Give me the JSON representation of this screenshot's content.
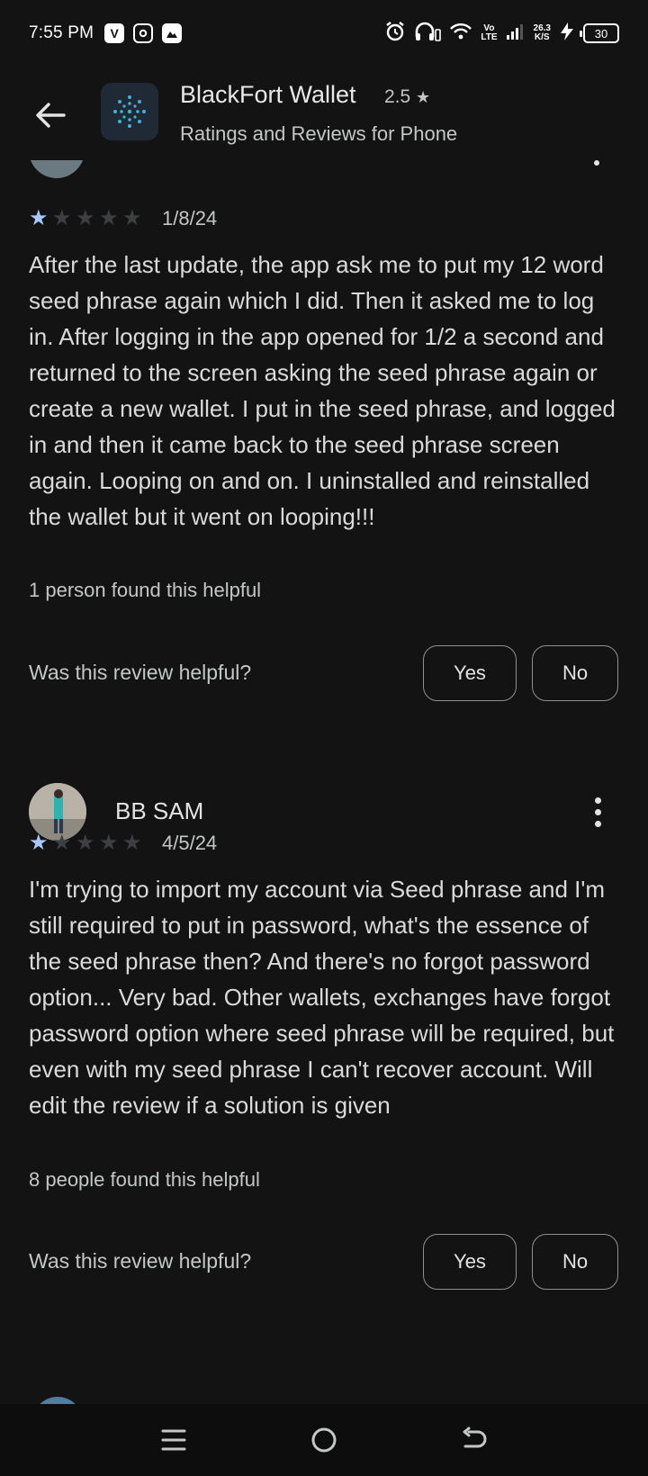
{
  "status_bar": {
    "time": "7:55 PM",
    "app_icons": [
      "V",
      "instagram-icon",
      "gallery-icon"
    ],
    "volte": "Vo\nLTE",
    "speed": "26.3",
    "speed_unit": "K/S",
    "battery": "30"
  },
  "header": {
    "app_name": "BlackFort Wallet",
    "rating": "2.5",
    "subtitle": "Ratings and Reviews for Phone"
  },
  "reviews": [
    {
      "stars_filled": 1,
      "stars_total": 5,
      "date": "1/8/24",
      "body": "After the last update, the app ask me to put my 12 word seed phrase again which I did. Then it asked me to log in. After logging in the app opened for 1/2 a second and returned to the screen asking the seed phrase again or create a new wallet. I put in the seed phrase, and logged in and then it came back to the seed phrase screen again. Looping on and on. I uninstalled and reinstalled the wallet but it went on looping!!!",
      "helpful_count": "1 person found this helpful",
      "helpful_question": "Was this review helpful?",
      "yes_label": "Yes",
      "no_label": "No"
    },
    {
      "reviewer": "BB SAM",
      "stars_filled": 1,
      "stars_total": 5,
      "date": "4/5/24",
      "body": "I'm trying to import my account via Seed phrase and I'm still required to put in password, what's the essence of the seed phrase then? And there's no forgot password option... Very bad. Other wallets, exchanges have forgot password option where seed phrase will be required, but even with my seed phrase I can't recover account. Will edit the review if a solution is given",
      "helpful_count": "8 people found this helpful",
      "helpful_question": "Was this review helpful?",
      "yes_label": "Yes",
      "no_label": "No"
    }
  ],
  "colors": {
    "background": "#131314",
    "star_filled": "#a8c7fa",
    "star_empty": "#3d3f42"
  }
}
